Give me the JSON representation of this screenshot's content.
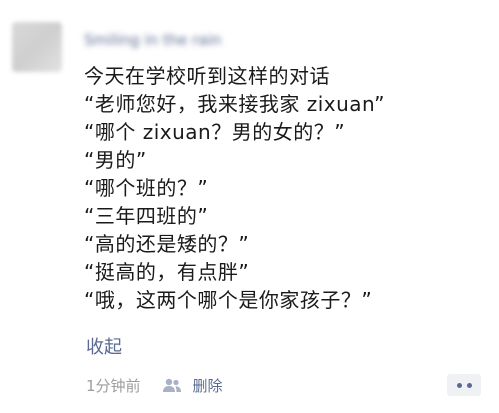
{
  "post": {
    "username": "Smiling in the rain",
    "lines": [
      "今天在学校听到这样的对话",
      "“老师您好，我来接我家 zixuan”",
      "“哪个 zixuan？男的女的？”",
      "“男的”",
      "“哪个班的？”",
      "“三年四班的”",
      "“高的还是矮的？”",
      "“挺高的，有点胖”",
      "“哦，这两个哪个是你家孩子？”"
    ],
    "collapse_label": "收起",
    "timestamp": "1分钟前",
    "delete_label": "删除",
    "icons": {
      "visibility": "people-icon",
      "more": "more-icon"
    },
    "colors": {
      "link": "#5b6a92",
      "text": "#1a1a1a",
      "meta": "#9e9e9e"
    }
  }
}
